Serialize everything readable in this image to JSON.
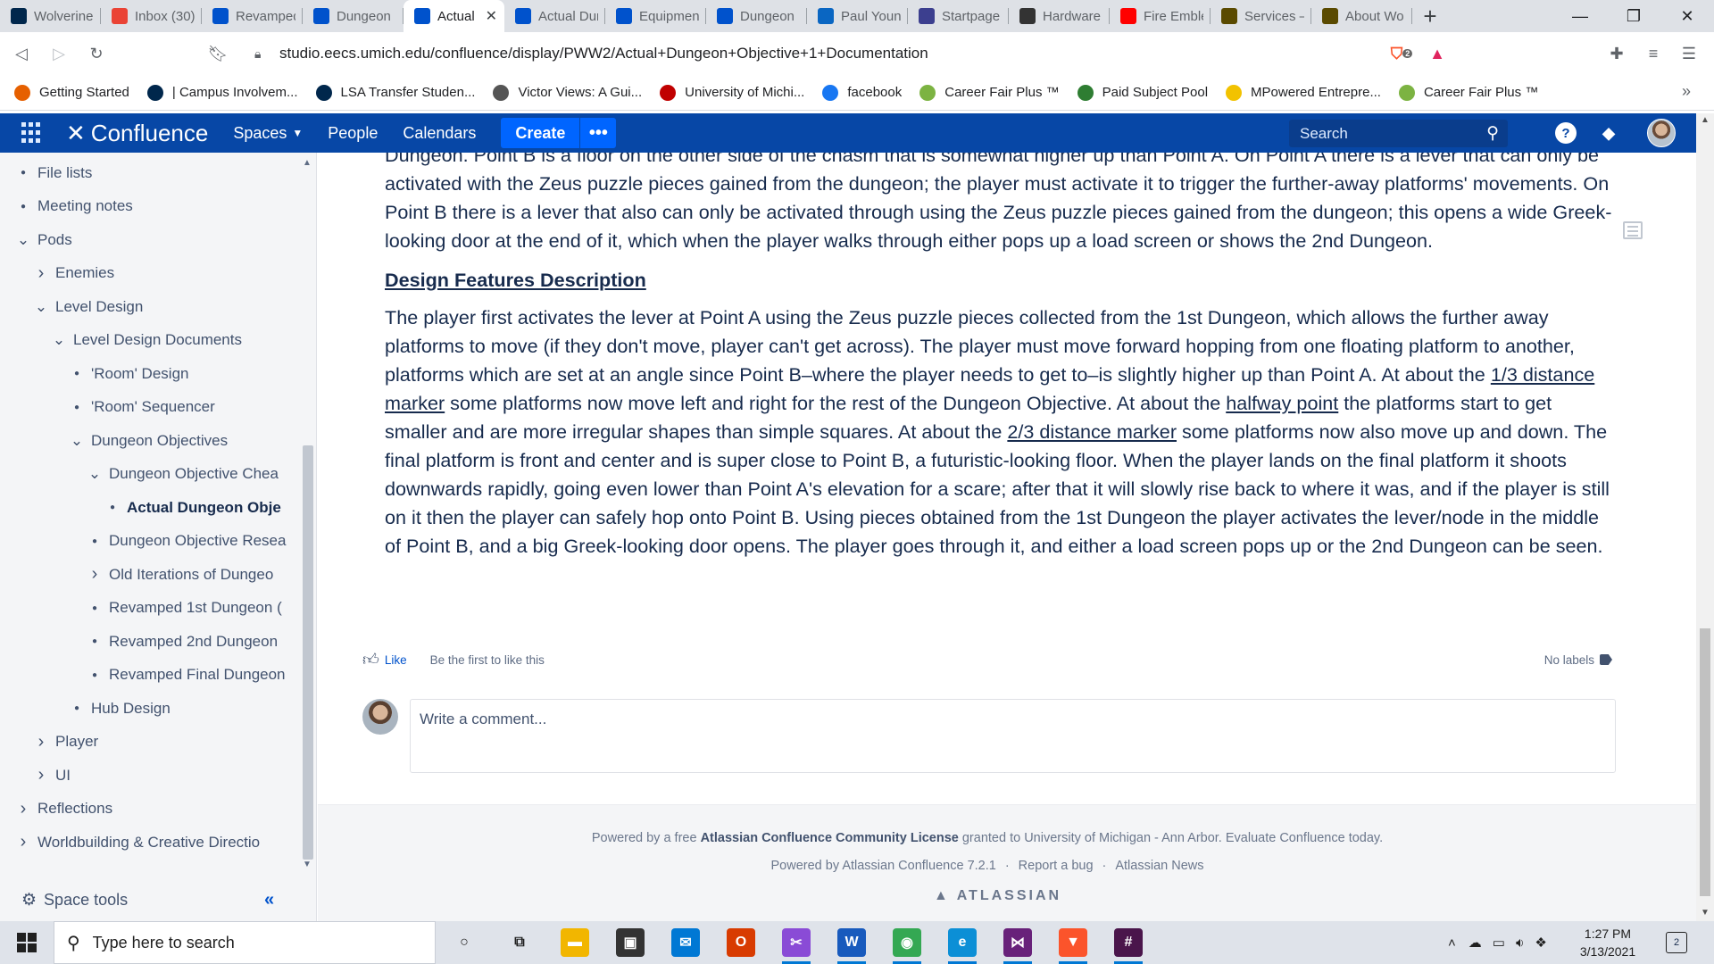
{
  "browser": {
    "tabs": [
      {
        "label": "Wolverine",
        "icon": "michigan-m-icon",
        "color": "#00274c"
      },
      {
        "label": "Inbox (30)",
        "icon": "gmail-icon",
        "color": "#ea4335"
      },
      {
        "label": "Revamped",
        "icon": "confluence-icon",
        "color": "#0052cc"
      },
      {
        "label": "Dungeon",
        "icon": "confluence-icon",
        "color": "#0052cc"
      },
      {
        "label": "Actual",
        "icon": "confluence-icon",
        "color": "#0052cc",
        "active": true
      },
      {
        "label": "Actual Dun",
        "icon": "confluence-icon",
        "color": "#0052cc"
      },
      {
        "label": "Equipment",
        "icon": "confluence-icon",
        "color": "#0052cc"
      },
      {
        "label": "Dungeon",
        "icon": "confluence-icon",
        "color": "#0052cc"
      },
      {
        "label": "Paul Young",
        "icon": "linkedin-icon",
        "color": "#0a66c2"
      },
      {
        "label": "Startpage",
        "icon": "startpage-icon",
        "color": "#3c3f8f"
      },
      {
        "label": "Hardware",
        "icon": "hardware-icon",
        "color": "#333333"
      },
      {
        "label": "Fire Emble",
        "icon": "youtube-icon",
        "color": "#ff0000"
      },
      {
        "label": "Services —",
        "icon": "services-icon",
        "color": "#5a4a00"
      },
      {
        "label": "About Wo",
        "icon": "about-icon",
        "color": "#5a4a00"
      }
    ],
    "url": "studio.eecs.umich.edu/confluence/display/PWW2/Actual+Dungeon+Objective+1+Documentation",
    "brave_badge": "2",
    "bookmarks": [
      {
        "label": "Getting Started",
        "icon": "firefox-icon",
        "color": "#e66000"
      },
      {
        "label": "| Campus Involvem...",
        "icon": "michigan-m-icon",
        "color": "#00274c"
      },
      {
        "label": "LSA Transfer Studen...",
        "icon": "lsa-icon",
        "color": "#00274c"
      },
      {
        "label": "Victor Views: A Gui...",
        "icon": "globe-icon",
        "color": "#555555"
      },
      {
        "label": "University of Michi...",
        "icon": "umich-icon",
        "color": "#c00000"
      },
      {
        "label": "facebook",
        "icon": "facebook-icon",
        "color": "#1877f2"
      },
      {
        "label": "Career Fair Plus ™",
        "icon": "careerfair-icon",
        "color": "#7cb342"
      },
      {
        "label": "Paid Subject Pool",
        "icon": "subjectpool-icon",
        "color": "#2e7d32"
      },
      {
        "label": "MPowered Entrepre...",
        "icon": "mpowered-icon",
        "color": "#f2c200"
      },
      {
        "label": "Career Fair Plus ™",
        "icon": "careerfair-icon",
        "color": "#7cb342"
      }
    ]
  },
  "confluence": {
    "logo": "Confluence",
    "nav": {
      "spaces": "Spaces",
      "people": "People",
      "calendars": "Calendars",
      "create": "Create",
      "more": "•••"
    },
    "search_placeholder": "Search"
  },
  "sidebar": {
    "items": [
      {
        "label": "File lists",
        "level": 0,
        "kind": "dot"
      },
      {
        "label": "Meeting notes",
        "level": 0,
        "kind": "dot"
      },
      {
        "label": "Pods",
        "level": 0,
        "kind": "expanded"
      },
      {
        "label": "Enemies",
        "level": 1,
        "kind": "collapsed"
      },
      {
        "label": "Level Design",
        "level": 1,
        "kind": "expanded"
      },
      {
        "label": "Level Design Documents",
        "level": 2,
        "kind": "expanded"
      },
      {
        "label": "'Room' Design",
        "level": 3,
        "kind": "dot"
      },
      {
        "label": "'Room' Sequencer",
        "level": 3,
        "kind": "dot"
      },
      {
        "label": "Dungeon Objectives",
        "level": 3,
        "kind": "expanded"
      },
      {
        "label": "Dungeon Objective Chea",
        "level": 4,
        "kind": "expanded"
      },
      {
        "label": "Actual Dungeon Obje",
        "level": 5,
        "kind": "dot",
        "current": true
      },
      {
        "label": "Dungeon Objective Resea",
        "level": 4,
        "kind": "dot"
      },
      {
        "label": "Old Iterations of Dungeo",
        "level": 4,
        "kind": "collapsed"
      },
      {
        "label": "Revamped 1st Dungeon (",
        "level": 4,
        "kind": "dot"
      },
      {
        "label": "Revamped 2nd Dungeon",
        "level": 4,
        "kind": "dot"
      },
      {
        "label": "Revamped Final Dungeon",
        "level": 4,
        "kind": "dot"
      },
      {
        "label": "Hub Design",
        "level": 3,
        "kind": "dot"
      },
      {
        "label": "Player",
        "level": 1,
        "kind": "collapsed"
      },
      {
        "label": "UI",
        "level": 1,
        "kind": "collapsed"
      },
      {
        "label": "Reflections",
        "level": 0,
        "kind": "collapsed"
      },
      {
        "label": "Worldbuilding & Creative Directio",
        "level": 0,
        "kind": "collapsed"
      }
    ],
    "space_tools": "Space tools"
  },
  "article": {
    "para1": "Dungeon. Point B is a floor on the other side of the chasm that is somewhat higher up than Point A. On Point A there is a lever that can only be activated with the Zeus puzzle pieces gained from the dungeon; the player must activate it to trigger the further-away platforms' movements. On Point B there is a lever that also can only be activated through using the Zeus puzzle pieces gained from the dungeon; this opens a wide Greek-looking door at the end of it, which when the player walks through either pops up a load screen or shows the 2nd Dungeon.",
    "heading": "Design Features Description",
    "p2_a": "The player first activates the lever at Point A using the Zeus puzzle pieces collected from the 1st Dungeon, which allows the further away platforms to move (if they don't move, player can't get across). The player must move forward hopping from one floating platform to another, platforms which are set at an angle since Point B–where the player needs to get to–is slightly higher up than Point A. At about the ",
    "p2_link1": "1/3 distance marker",
    "p2_b": " some platforms now move left and right for the rest of the Dungeon Objective. At about the ",
    "p2_link2": "halfway point",
    "p2_c": " the platforms start to get smaller and are more irregular shapes than simple squares. At about the ",
    "p2_link3": "2/3 distance marker",
    "p2_d": " some platforms now also move up and down. The final platform is front and center and is super close to Point B, a futuristic-looking floor. When the player lands on the final platform it shoots downwards rapidly, going even lower than Point A's elevation for a scare; after that it will slowly rise back to where it was, and if the player is still on it then the player can safely hop onto Point B. Using pieces obtained from the 1st Dungeon the player activates the lever/node in the middle of Point B, and a big Greek-looking door opens. The player goes through it, and either a load screen pops up or the 2nd Dungeon can be seen."
  },
  "likes": {
    "like": "Like",
    "first": "Be the first to like this",
    "labels": "No labels"
  },
  "comment": {
    "placeholder": "Write a comment..."
  },
  "footer": {
    "line1_pre": "Powered by a free ",
    "line1_bold": "Atlassian Confluence Community License",
    "line1_post": " granted to University of Michigan - Ann Arbor. Evaluate Confluence today.",
    "powered": "Powered by Atlassian Confluence 7.2.1",
    "report": "Report a bug",
    "news": "Atlassian News",
    "brand": "ATLASSIAN"
  },
  "taskbar": {
    "search_placeholder": "Type here to search",
    "time": "1:27 PM",
    "date": "3/13/2021",
    "notifications": "2",
    "apps": [
      {
        "name": "cortana-icon",
        "color": "#202020",
        "glyph": "○"
      },
      {
        "name": "task-view-icon",
        "color": "#202020",
        "glyph": "⧉"
      },
      {
        "name": "file-explorer-icon",
        "color": "#f2b600",
        "glyph": "▬"
      },
      {
        "name": "store-icon",
        "color": "#333333",
        "glyph": "▣"
      },
      {
        "name": "mail-icon",
        "color": "#0078d4",
        "glyph": "✉"
      },
      {
        "name": "office-icon",
        "color": "#d83b01",
        "glyph": "O"
      },
      {
        "name": "snip-icon",
        "color": "#8a4bd6",
        "glyph": "✂"
      },
      {
        "name": "word-icon",
        "color": "#185abd",
        "glyph": "W"
      },
      {
        "name": "chrome-icon",
        "color": "#34a853",
        "glyph": "◉"
      },
      {
        "name": "edge-icon",
        "color": "#0c8fd6",
        "glyph": "e"
      },
      {
        "name": "visual-studio-icon",
        "color": "#68217a",
        "glyph": "⋈"
      },
      {
        "name": "brave-icon",
        "color": "#fb542b",
        "glyph": "▼"
      },
      {
        "name": "slack-icon",
        "color": "#4a154b",
        "glyph": "#"
      }
    ]
  }
}
